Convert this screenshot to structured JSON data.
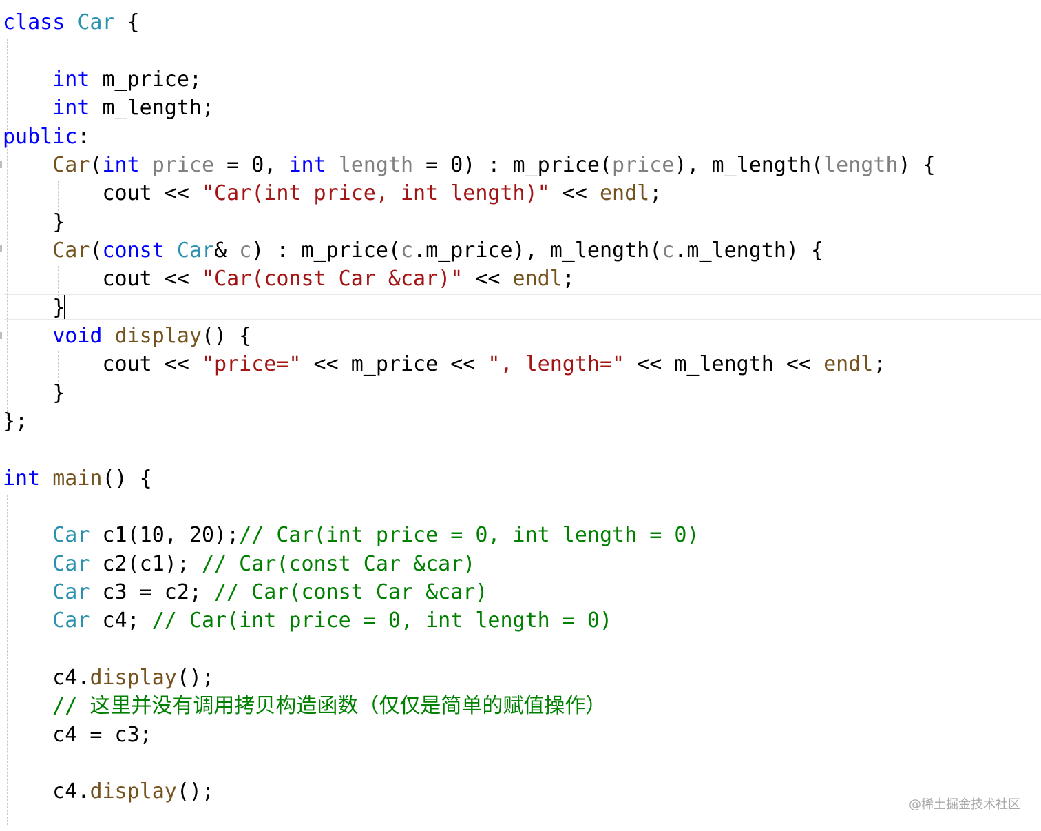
{
  "colors": {
    "keyword": "#0000ff",
    "type": "#2b91af",
    "function": "#74531f",
    "parameter": "#808080",
    "string": "#a31515",
    "comment": "#008000",
    "plain": "#000000"
  },
  "code": {
    "lines": [
      {
        "tokens": [
          {
            "t": "class",
            "c": "keyword"
          },
          {
            "t": " ",
            "c": "plain"
          },
          {
            "t": "Car",
            "c": "type"
          },
          {
            "t": " {",
            "c": "plain"
          }
        ]
      },
      {
        "tokens": []
      },
      {
        "tokens": [
          {
            "t": "    ",
            "c": "plain"
          },
          {
            "t": "int",
            "c": "keyword"
          },
          {
            "t": " m_price;",
            "c": "plain"
          }
        ]
      },
      {
        "tokens": [
          {
            "t": "    ",
            "c": "plain"
          },
          {
            "t": "int",
            "c": "keyword"
          },
          {
            "t": " m_length;",
            "c": "plain"
          }
        ]
      },
      {
        "tokens": [
          {
            "t": "public",
            "c": "keyword"
          },
          {
            "t": ":",
            "c": "plain"
          }
        ]
      },
      {
        "tokens": [
          {
            "t": "    ",
            "c": "plain"
          },
          {
            "t": "Car",
            "c": "function"
          },
          {
            "t": "(",
            "c": "plain"
          },
          {
            "t": "int",
            "c": "keyword"
          },
          {
            "t": " ",
            "c": "plain"
          },
          {
            "t": "price",
            "c": "parameter"
          },
          {
            "t": " = 0, ",
            "c": "plain"
          },
          {
            "t": "int",
            "c": "keyword"
          },
          {
            "t": " ",
            "c": "plain"
          },
          {
            "t": "length",
            "c": "parameter"
          },
          {
            "t": " = 0) : m_price(",
            "c": "plain"
          },
          {
            "t": "price",
            "c": "parameter"
          },
          {
            "t": "), m_length(",
            "c": "plain"
          },
          {
            "t": "length",
            "c": "parameter"
          },
          {
            "t": ") {",
            "c": "plain"
          }
        ]
      },
      {
        "tokens": [
          {
            "t": "        cout << ",
            "c": "plain"
          },
          {
            "t": "\"Car(int price, int length)\"",
            "c": "string"
          },
          {
            "t": " << ",
            "c": "plain"
          },
          {
            "t": "endl",
            "c": "function"
          },
          {
            "t": ";",
            "c": "plain"
          }
        ]
      },
      {
        "tokens": [
          {
            "t": "    }",
            "c": "plain"
          }
        ]
      },
      {
        "tokens": [
          {
            "t": "    ",
            "c": "plain"
          },
          {
            "t": "Car",
            "c": "function"
          },
          {
            "t": "(",
            "c": "plain"
          },
          {
            "t": "const",
            "c": "keyword"
          },
          {
            "t": " ",
            "c": "plain"
          },
          {
            "t": "Car",
            "c": "type"
          },
          {
            "t": "& ",
            "c": "plain"
          },
          {
            "t": "c",
            "c": "parameter"
          },
          {
            "t": ") : m_price(",
            "c": "plain"
          },
          {
            "t": "c",
            "c": "parameter"
          },
          {
            "t": ".m_price), m_length(",
            "c": "plain"
          },
          {
            "t": "c",
            "c": "parameter"
          },
          {
            "t": ".m_length) {",
            "c": "plain"
          }
        ]
      },
      {
        "tokens": [
          {
            "t": "        cout << ",
            "c": "plain"
          },
          {
            "t": "\"Car(const Car &car)\"",
            "c": "string"
          },
          {
            "t": " << ",
            "c": "plain"
          },
          {
            "t": "endl",
            "c": "function"
          },
          {
            "t": ";",
            "c": "plain"
          }
        ]
      },
      {
        "tokens": [
          {
            "t": "    }",
            "c": "plain"
          }
        ]
      },
      {
        "tokens": [
          {
            "t": "    ",
            "c": "plain"
          },
          {
            "t": "void",
            "c": "keyword"
          },
          {
            "t": " ",
            "c": "plain"
          },
          {
            "t": "display",
            "c": "function"
          },
          {
            "t": "() {",
            "c": "plain"
          }
        ]
      },
      {
        "tokens": [
          {
            "t": "        cout << ",
            "c": "plain"
          },
          {
            "t": "\"price=\"",
            "c": "string"
          },
          {
            "t": " << m_price << ",
            "c": "plain"
          },
          {
            "t": "\", length=\"",
            "c": "string"
          },
          {
            "t": " << m_length << ",
            "c": "plain"
          },
          {
            "t": "endl",
            "c": "function"
          },
          {
            "t": ";",
            "c": "plain"
          }
        ]
      },
      {
        "tokens": [
          {
            "t": "    }",
            "c": "plain"
          }
        ]
      },
      {
        "tokens": [
          {
            "t": "};",
            "c": "plain"
          }
        ]
      },
      {
        "tokens": []
      },
      {
        "tokens": [
          {
            "t": "int",
            "c": "keyword"
          },
          {
            "t": " ",
            "c": "plain"
          },
          {
            "t": "main",
            "c": "function"
          },
          {
            "t": "() {",
            "c": "plain"
          }
        ]
      },
      {
        "tokens": []
      },
      {
        "tokens": [
          {
            "t": "    ",
            "c": "plain"
          },
          {
            "t": "Car",
            "c": "type"
          },
          {
            "t": " c1(10, 20);",
            "c": "plain"
          },
          {
            "t": "// Car(int price = 0, int length = 0)",
            "c": "comment"
          }
        ]
      },
      {
        "tokens": [
          {
            "t": "    ",
            "c": "plain"
          },
          {
            "t": "Car",
            "c": "type"
          },
          {
            "t": " c2(c1); ",
            "c": "plain"
          },
          {
            "t": "// Car(const Car &car)",
            "c": "comment"
          }
        ]
      },
      {
        "tokens": [
          {
            "t": "    ",
            "c": "plain"
          },
          {
            "t": "Car",
            "c": "type"
          },
          {
            "t": " c3 = c2; ",
            "c": "plain"
          },
          {
            "t": "// Car(const Car &car)",
            "c": "comment"
          }
        ]
      },
      {
        "tokens": [
          {
            "t": "    ",
            "c": "plain"
          },
          {
            "t": "Car",
            "c": "type"
          },
          {
            "t": " c4; ",
            "c": "plain"
          },
          {
            "t": "// Car(int price = 0, int length = 0)",
            "c": "comment"
          }
        ]
      },
      {
        "tokens": []
      },
      {
        "tokens": [
          {
            "t": "    c4.",
            "c": "plain"
          },
          {
            "t": "display",
            "c": "function"
          },
          {
            "t": "();",
            "c": "plain"
          }
        ]
      },
      {
        "tokens": [
          {
            "t": "    ",
            "c": "plain"
          },
          {
            "t": "// 这里并没有调用拷贝构造函数（仅仅是简单的赋值操作）",
            "c": "comment"
          }
        ]
      },
      {
        "tokens": [
          {
            "t": "    c4 = c3;",
            "c": "plain"
          }
        ]
      },
      {
        "tokens": []
      },
      {
        "tokens": [
          {
            "t": "    c4.",
            "c": "plain"
          },
          {
            "t": "display",
            "c": "function"
          },
          {
            "t": "();",
            "c": "plain"
          }
        ]
      }
    ]
  },
  "watermark": "@稀土掘金技术社区"
}
